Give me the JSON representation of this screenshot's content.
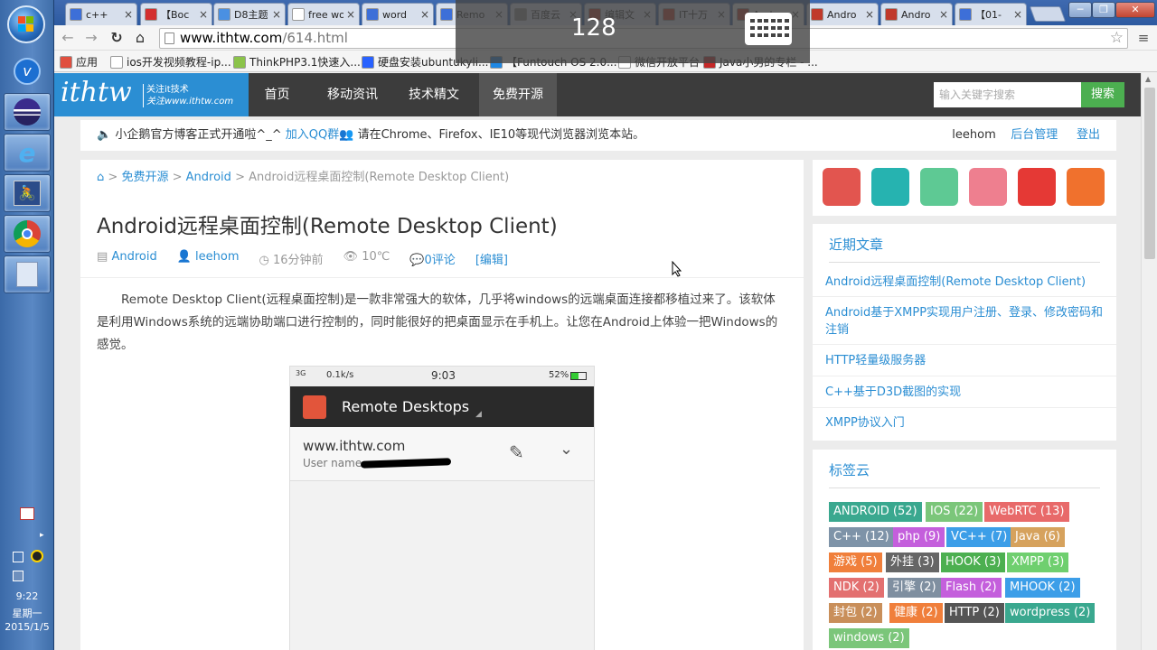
{
  "taskbar": {
    "clock_time": "9:22",
    "clock_day": "星期一",
    "clock_date": "2015/1/5"
  },
  "tabs": [
    {
      "title": "c++",
      "fav_color": "#3d6fd8"
    },
    {
      "title": "【Boc",
      "fav_color": "#d32f2f"
    },
    {
      "title": "D8主题",
      "fav_color": "#4a90e2"
    },
    {
      "title": "free word",
      "fav_color": "#ffffff"
    },
    {
      "title": "word",
      "fav_color": "#3d6fd8"
    },
    {
      "title": "Remo",
      "fav_color": "#3d6fd8"
    },
    {
      "title": "百度云",
      "fav_color": "#8a8a8a"
    },
    {
      "title": "编辑文",
      "fav_color": "#c0392b"
    },
    {
      "title": "IT十万",
      "fav_color": "#c0392b"
    },
    {
      "title": "Andro",
      "fav_color": "#c0392b"
    },
    {
      "title": "Andro",
      "fav_color": "#c0392b"
    },
    {
      "title": "Andro",
      "fav_color": "#c0392b"
    },
    {
      "title": "【01-",
      "fav_color": "#3d6fd8"
    }
  ],
  "address": {
    "host": "www.ithtw.com",
    "path": "/614.html"
  },
  "bookmarks": [
    {
      "label": "应用",
      "color": "#e04f3f"
    },
    {
      "label": "ios开发视频教程-ip...",
      "color": "#ffffff"
    },
    {
      "label": "ThinkPHP3.1快速入...",
      "color": "#8bc34a"
    },
    {
      "label": "硬盘安装ubuntukyli...",
      "color": "#2962ff"
    },
    {
      "label": "【Funtouch OS 2.0...",
      "color": "#1e88e5"
    },
    {
      "label": "微信开放平台",
      "color": "#ffffff"
    },
    {
      "label": "Java小男的专栏 - ...",
      "color": "#c62828"
    }
  ],
  "osd": {
    "value": "128"
  },
  "site": {
    "logo_text": "ithtw",
    "logo_sub1": "关注it技术",
    "logo_sub2": "关注www.ithtw.com",
    "nav": [
      "首页",
      "移动资讯",
      "技术精文",
      "免费开源"
    ],
    "search_placeholder": "输入关键字搜索",
    "search_button": "搜索"
  },
  "notice": {
    "text1": "小企鹅官方博客正式开通啦^_^",
    "link": "加入QQ群",
    "text2": "请在Chrome、Firefox、IE10等现代浏览器浏览本站。",
    "user": "leehom",
    "admin": "后台管理",
    "logout": "登出"
  },
  "breadcrumb": {
    "sep": ">",
    "c1": "免费开源",
    "c2": "Android",
    "c3": "Android远程桌面控制(Remote Desktop Client)"
  },
  "article": {
    "title": "Android远程桌面控制(Remote Desktop Client)",
    "category": "Android",
    "author": "leehom",
    "time": "16分钟前",
    "views": "10℃",
    "comments": "0评论",
    "edit": "[编辑]",
    "body": "Remote Desktop Client(远程桌面控制)是一款非常强大的软体，几乎将windows的远端桌面连接都移植过来了。该软体是利用Windows系统的远端协助端口进行控制的，同时能很好的把桌面显示在手机上。让您在Android上体验一把Windows的感觉。"
  },
  "phone": {
    "signal": "3G",
    "speed": "0.1k/s",
    "time": "9:03",
    "battery": "52%",
    "app_title": "Remote Desktops",
    "host": "www.ithtw.com",
    "user_label": "User name"
  },
  "social_colors": [
    "#e2554f",
    "#26b3b0",
    "#5ec994",
    "#ee7f8f",
    "#e53935",
    "#f0712d"
  ],
  "recent": {
    "title": "近期文章",
    "items": [
      "Android远程桌面控制(Remote Desktop Client)",
      "Android基于XMPP实现用户注册、登录、修改密码和注销",
      "HTTP轻量级服务器",
      "C++基于D3D截图的实现",
      "XMPP协议入门"
    ]
  },
  "tags": {
    "title": "标签云",
    "items": [
      {
        "label": "ANDROID (52)",
        "color": "#3aa88f"
      },
      {
        "label": "IOS (22)",
        "color": "#7bc67a"
      },
      {
        "label": "WebRTC (13)",
        "color": "#e86a6a"
      },
      {
        "label": "C++ (12)",
        "color": "#7e93a8"
      },
      {
        "label": "php (9)",
        "color": "#c45fdc"
      },
      {
        "label": "VC++ (7)",
        "color": "#3c9ee8"
      },
      {
        "label": "Java (6)",
        "color": "#d6a25d"
      },
      {
        "label": "游戏 (5)",
        "color": "#f07f3b"
      },
      {
        "label": "外挂 (3)",
        "color": "#666666"
      },
      {
        "label": "HOOK (3)",
        "color": "#4caf50"
      },
      {
        "label": "XMPP (3)",
        "color": "#6fcf6f"
      },
      {
        "label": "NDK (2)",
        "color": "#e37070"
      },
      {
        "label": "引擎 (2)",
        "color": "#7f8fa0"
      },
      {
        "label": "Flash (2)",
        "color": "#c45fdc"
      },
      {
        "label": "MHOOK (2)",
        "color": "#3c9ee8"
      },
      {
        "label": "封包 (2)",
        "color": "#c98f5a"
      },
      {
        "label": "健康 (2)",
        "color": "#f07f3b"
      },
      {
        "label": "HTTP (2)",
        "color": "#555555"
      },
      {
        "label": "wordpress (2)",
        "color": "#3aa88f"
      },
      {
        "label": "windows (2)",
        "color": "#7bc67a"
      }
    ]
  }
}
